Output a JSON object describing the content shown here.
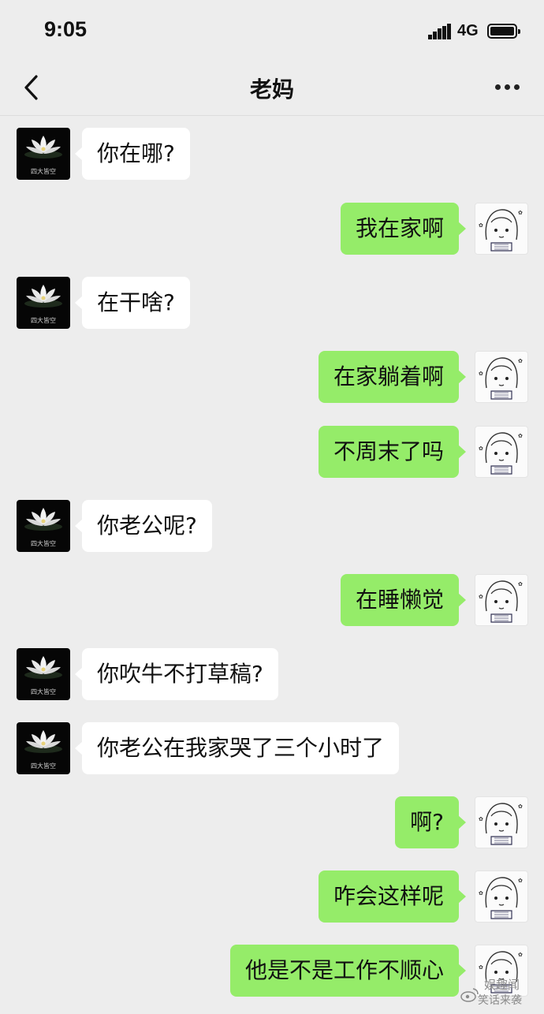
{
  "status": {
    "time": "9:05",
    "network": "4G"
  },
  "header": {
    "title": "老妈",
    "back_icon": "chevron-left-icon",
    "more_icon": "more-icon"
  },
  "contact": {
    "avatar_caption": "四大皆空"
  },
  "colors": {
    "background": "#ededed",
    "outgoing_bubble": "#95ec69",
    "incoming_bubble": "#ffffff"
  },
  "messages": [
    {
      "from": "mom",
      "text": "你在哪?"
    },
    {
      "from": "me",
      "text": "我在家啊"
    },
    {
      "from": "mom",
      "text": "在干啥?"
    },
    {
      "from": "me",
      "text": "在家躺着啊"
    },
    {
      "from": "me",
      "text": "不周末了吗"
    },
    {
      "from": "mom",
      "text": "你老公呢?"
    },
    {
      "from": "me",
      "text": "在睡懒觉"
    },
    {
      "from": "mom",
      "text": "你吹牛不打草稿?"
    },
    {
      "from": "mom",
      "text": "你老公在我家哭了三个小时了"
    },
    {
      "from": "me",
      "text": "啊?"
    },
    {
      "from": "me",
      "text": "咋会这样呢"
    },
    {
      "from": "me",
      "text": "他是不是工作不顺心"
    }
  ],
  "watermark": {
    "line1": "娱趣闻",
    "line2": "笑话来袭"
  }
}
